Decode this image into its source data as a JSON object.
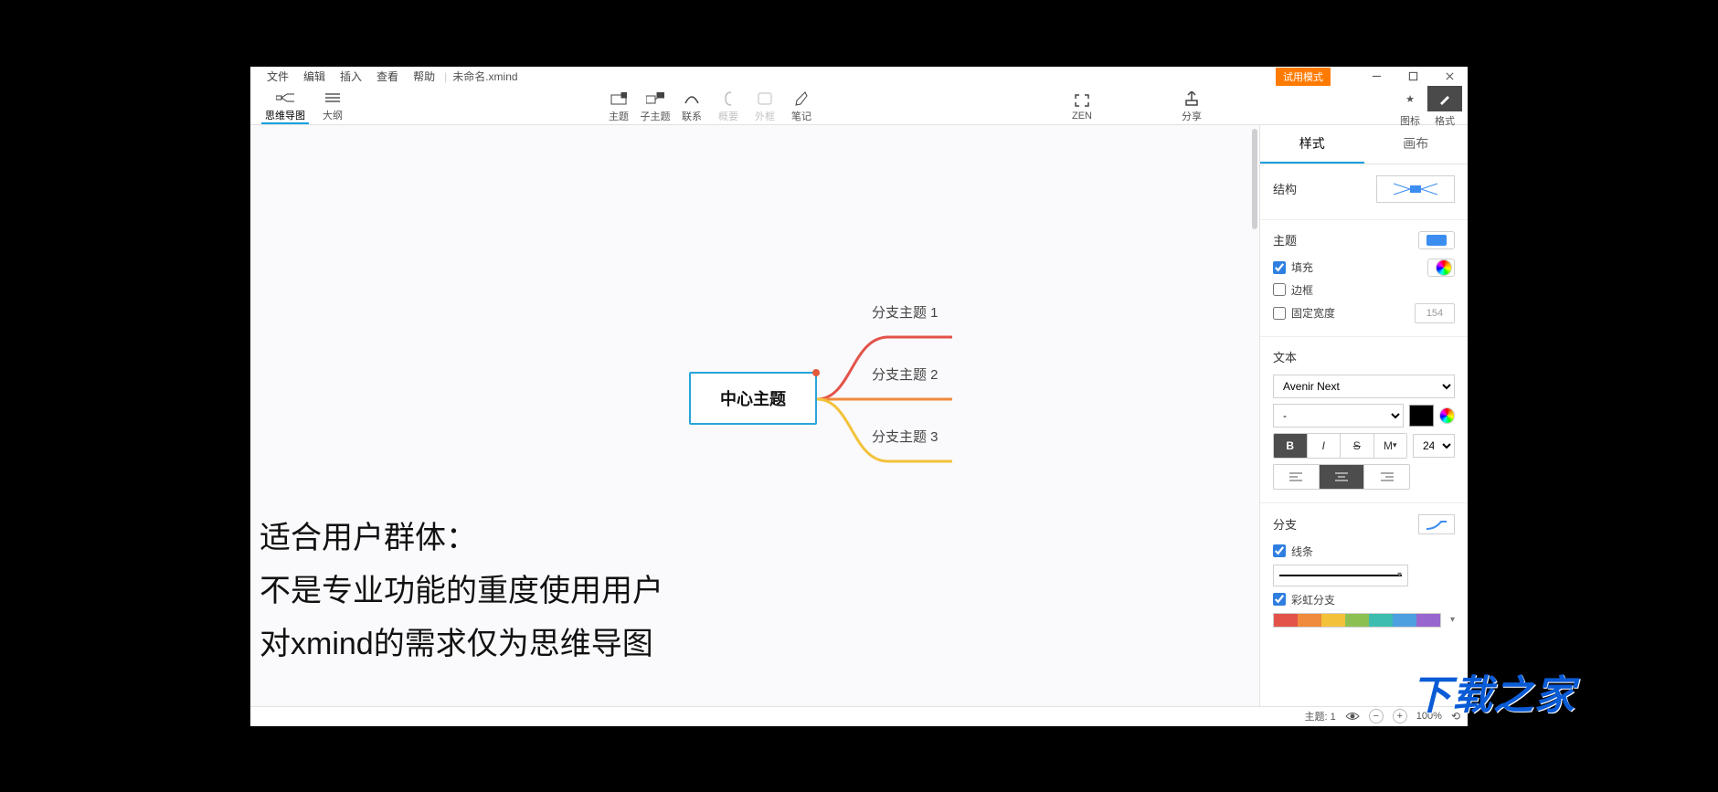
{
  "title": {
    "menus": [
      "文件",
      "编辑",
      "插入",
      "查看",
      "帮助"
    ],
    "doc": "未命名.xmind",
    "trial": "试用模式"
  },
  "toolbar": {
    "viewtabs": {
      "mindmap": "思维导图",
      "outline": "大纲"
    },
    "center_tools": {
      "topic": "主题",
      "subtopic": "子主题",
      "relation": "联系",
      "summary": "概要",
      "boundary": "外框",
      "notes": "笔记"
    },
    "zen": "ZEN",
    "share": "分享",
    "icons_lbl": "图标",
    "format_lbl": "格式"
  },
  "mindmap": {
    "center": "中心主题",
    "branches": [
      "分支主题 1",
      "分支主题 2",
      "分支主题 3"
    ]
  },
  "annotation": {
    "l1": "适合用户群体：",
    "l2": "不是专业功能的重度使用用户",
    "l3": "对xmind的需求仅为思维导图"
  },
  "watermark": "下载之家",
  "sidepanel": {
    "tabs": {
      "style": "样式",
      "canvas": "画布"
    },
    "structure": {
      "label": "结构"
    },
    "topic": {
      "label": "主题",
      "fill": "填充",
      "border": "边框",
      "fixed_width": "固定宽度",
      "width_value": "154"
    },
    "text": {
      "label": "文本",
      "font": "Avenir Next",
      "weight": "-",
      "size": "24",
      "B": "B",
      "I": "I",
      "S": "S",
      "M": "M"
    },
    "branch": {
      "label": "分支",
      "line": "线条",
      "rainbow": "彩虹分支"
    },
    "rainbow_colors": [
      "#e3534a",
      "#f08a3c",
      "#f3c23a",
      "#8cc152",
      "#3dbdb0",
      "#4da0e0",
      "#9866cf"
    ]
  },
  "status": {
    "topic_label": "主题:",
    "topic_count": "1",
    "zoom": "100%"
  }
}
